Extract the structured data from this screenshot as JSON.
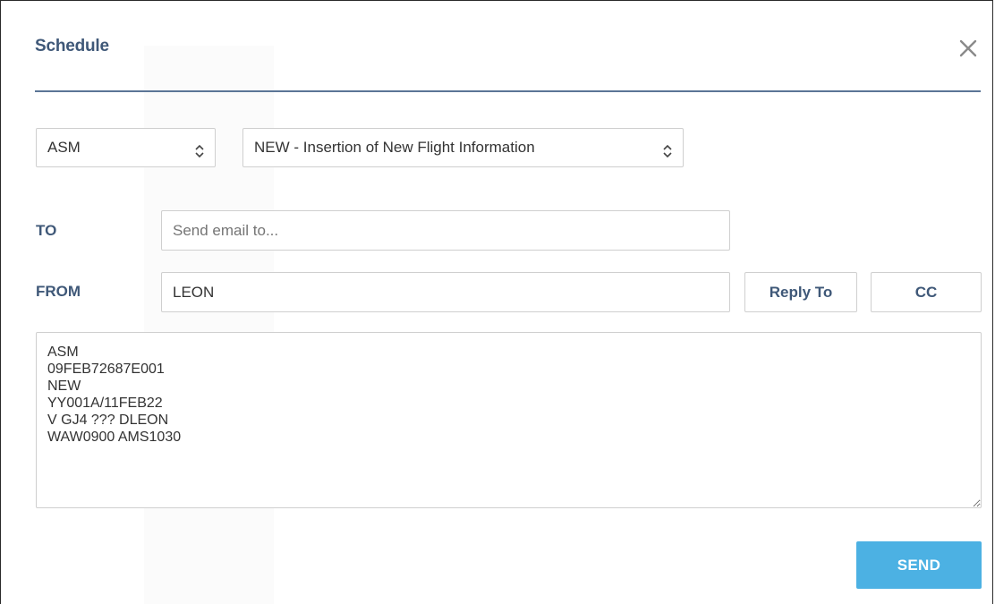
{
  "dialog": {
    "title": "Schedule",
    "close_icon": "close-icon"
  },
  "message_type": {
    "selected": "ASM",
    "icon": "updown-chevron-icon"
  },
  "action_type": {
    "selected": "NEW - Insertion of New Flight Information",
    "icon": "updown-chevron-icon"
  },
  "to": {
    "label": "TO",
    "placeholder": "Send email to...",
    "value": ""
  },
  "from": {
    "label": "FROM",
    "value": "LEON"
  },
  "buttons": {
    "reply_to": "Reply To",
    "cc": "CC",
    "send": "SEND"
  },
  "message_body": "ASM\n09FEB72687E001\nNEW\nYY001A/11FEB22\nV GJ4 ??? DLEON\nWAW0900 AMS1030",
  "colors": {
    "accent_text": "#3f5878",
    "send_button": "#4cb1e3",
    "divider": "#5b7596"
  }
}
